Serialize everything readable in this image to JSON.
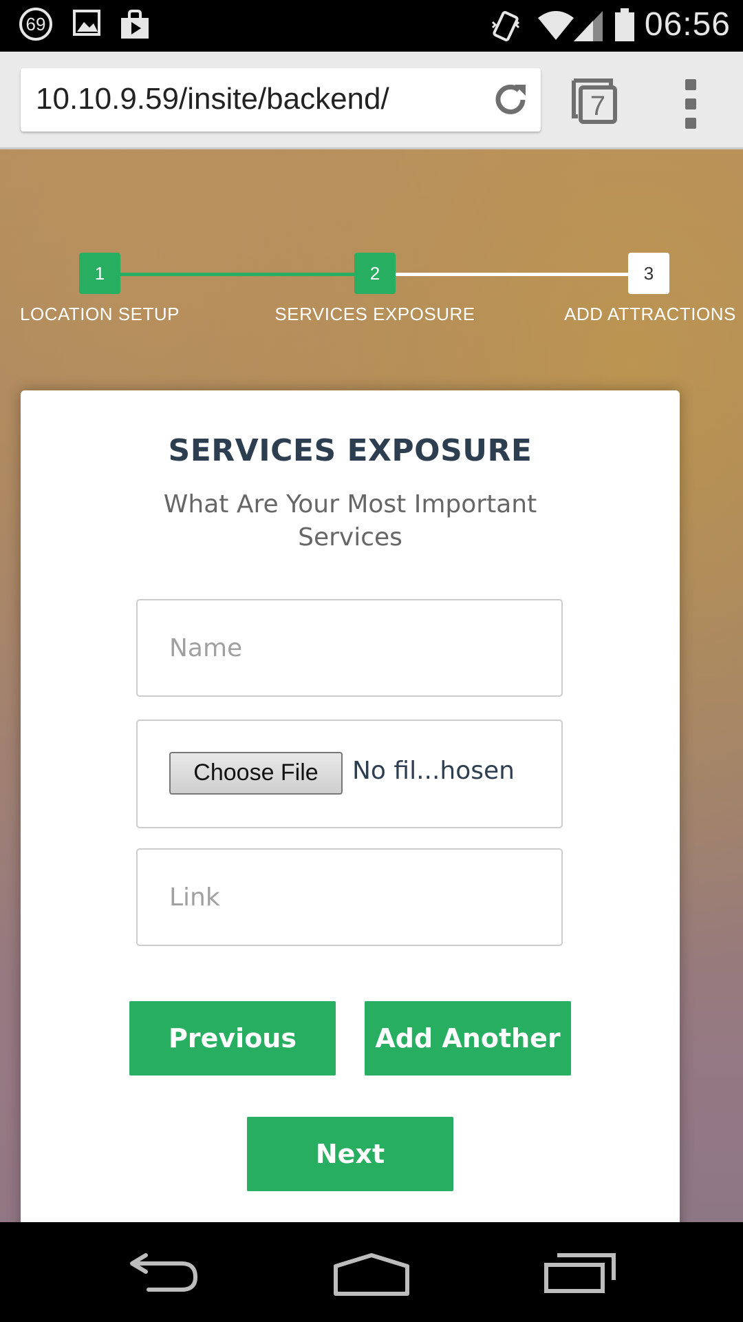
{
  "status_bar": {
    "notification_count": "69",
    "time": "06:56",
    "icons": [
      "notification-badge-icon",
      "image-icon",
      "play-store-icon",
      "vibrate-icon",
      "wifi-icon",
      "signal-icon",
      "battery-icon"
    ]
  },
  "browser": {
    "url": "10.10.9.59/insite/backend/",
    "tab_count": "7",
    "icons": [
      "reload-icon",
      "tabs-icon",
      "overflow-menu-icon"
    ]
  },
  "steps": [
    {
      "number": "1",
      "label": "LOCATION SETUP",
      "state": "done"
    },
    {
      "number": "2",
      "label": "SERVICES EXPOSURE",
      "state": "active"
    },
    {
      "number": "3",
      "label": "ADD ATTRACTIONS",
      "state": "pending"
    }
  ],
  "form": {
    "title": "SERVICES EXPOSURE",
    "subtitle": "What Are Your Most Important Services",
    "name_placeholder": "Name",
    "name_value": "",
    "file_button": "Choose File",
    "file_status": "No fil...hosen",
    "link_placeholder": "Link",
    "link_value": "",
    "previous_label": "Previous",
    "add_another_label": "Add Another",
    "next_label": "Next"
  },
  "colors": {
    "accent": "#27ae60",
    "title": "#2c3e50"
  },
  "nav_bar": {
    "icons": [
      "back-icon",
      "home-icon",
      "recents-icon"
    ]
  }
}
